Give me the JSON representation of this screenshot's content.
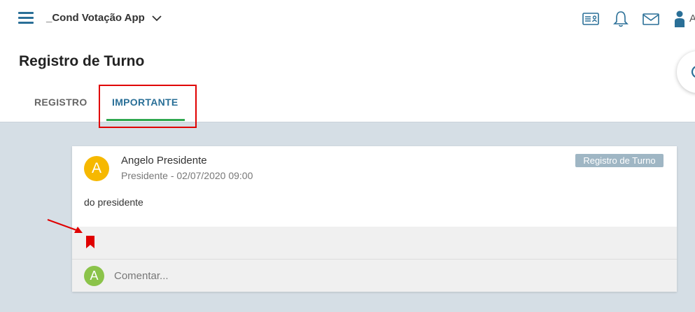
{
  "header": {
    "app_title": "_Cond Votação App",
    "icons": [
      "menu-icon",
      "chevron-down-icon",
      "id-card-icon",
      "bell-icon",
      "mail-icon",
      "user-icon"
    ],
    "user_extra": "A"
  },
  "page": {
    "title": "Registro de Turno"
  },
  "tabs": [
    {
      "label": "REGISTRO",
      "active": false
    },
    {
      "label": "IMPORTANTE",
      "active": true
    }
  ],
  "post": {
    "avatar_letter": "A",
    "author": "Angelo Presidente",
    "meta": "Presidente - 02/07/2020 09:00",
    "badge": "Registro de Turno",
    "body": "do presidente"
  },
  "comment": {
    "avatar_letter": "A",
    "placeholder": "Comentar..."
  },
  "colors": {
    "accent": "#2a6f97",
    "tab_indicator": "#2fa84f",
    "highlight": "#e00000",
    "avatar_post": "#f6b800",
    "avatar_comment": "#8bc34a",
    "badge": "#9fb6c4",
    "background": "#d5dee5"
  }
}
